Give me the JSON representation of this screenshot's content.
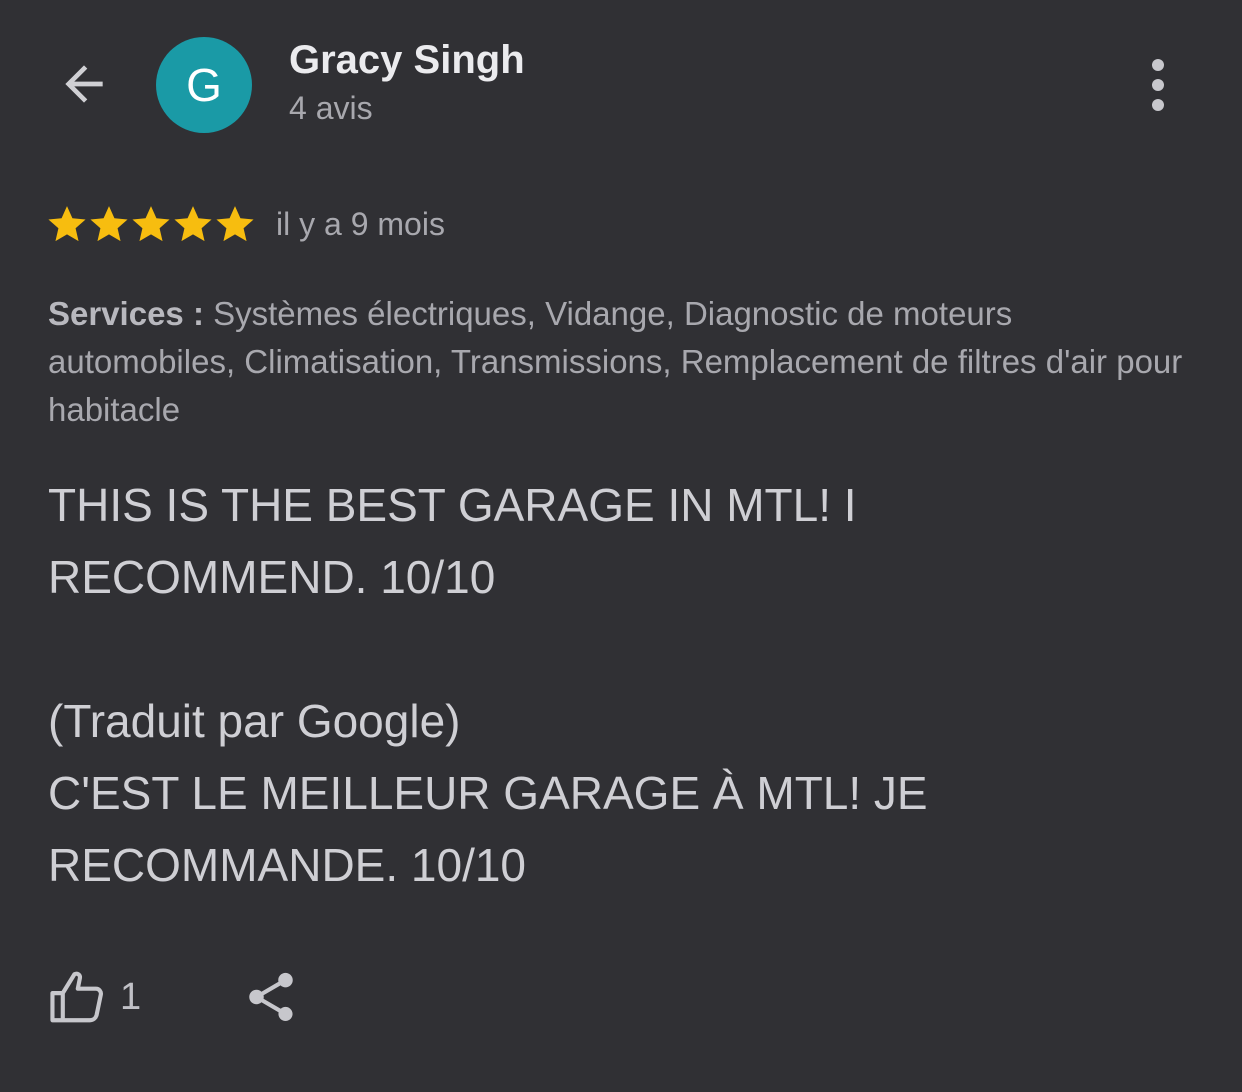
{
  "header": {
    "back_icon": "arrow-left-icon",
    "avatar_letter": "G",
    "avatar_color": "#1a9aa6",
    "author_name": "Gracy Singh",
    "review_count": "4 avis",
    "more_icon": "more-vertical-icon"
  },
  "rating": {
    "stars": 5,
    "max_stars": 5,
    "star_color": "#f7bd0f",
    "time_ago": "il y a 9 mois"
  },
  "services": {
    "label": "Services :",
    "value": "Systèmes électriques, Vidange, Diagnostic de moteurs automobiles, Climatisation, Transmissions, Remplacement de filtres d'air pour habitacle"
  },
  "review": {
    "original": "THIS IS THE BEST GARAGE IN MTL! I RECOMMEND. 10/10",
    "translated_label": "(Traduit par Google)",
    "translated": "C'EST LE MEILLEUR GARAGE À MTL! JE RECOMMANDE. 10/10"
  },
  "actions": {
    "like_icon": "thumbs-up-icon",
    "like_count": "1",
    "share_icon": "share-icon"
  },
  "colors": {
    "background": "#303034",
    "text_primary": "#ebebee",
    "text_secondary": "#a8a8ae"
  }
}
